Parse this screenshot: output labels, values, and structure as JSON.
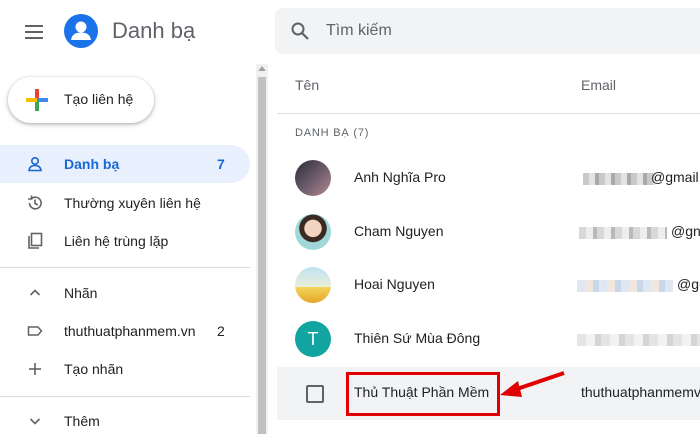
{
  "header": {
    "title": "Danh bạ",
    "search_placeholder": "Tìm kiếm"
  },
  "sidebar": {
    "create_label": "Tạo liên hệ",
    "items": [
      {
        "label": "Danh bạ",
        "count": "7",
        "icon": "person-icon"
      },
      {
        "label": "Thường xuyên liên hệ",
        "icon": "history-icon"
      },
      {
        "label": "Liên hệ trùng lặp",
        "icon": "copy-icon"
      }
    ],
    "labels_section": "Nhãn",
    "labels": [
      {
        "label": "thuthuatphanmem.vn",
        "count": "2",
        "icon": "label-icon"
      }
    ],
    "create_label_tag": "Tạo nhãn",
    "more": "Thêm"
  },
  "main": {
    "col_name": "Tên",
    "col_email": "Email",
    "section": "DANH BẠ (7)",
    "contacts": [
      {
        "name": "Anh Nghĩa Pro",
        "email_suffix": "@gmail."
      },
      {
        "name": "Cham Nguyen",
        "email_suffix": "@gn"
      },
      {
        "name": "Hoai Nguyen",
        "email_suffix": "@gu"
      },
      {
        "name": "Thiên Sứ Mùa Đông",
        "avatar_letter": "T"
      },
      {
        "name": "Thủ Thuật Phần Mềm",
        "email": "thuthuatphanmemv"
      }
    ]
  },
  "colors": {
    "accent": "#1a73e8",
    "active_bg": "#e8f0fe",
    "highlight": "#e00000",
    "avatar_teal": "#12a4a0"
  }
}
